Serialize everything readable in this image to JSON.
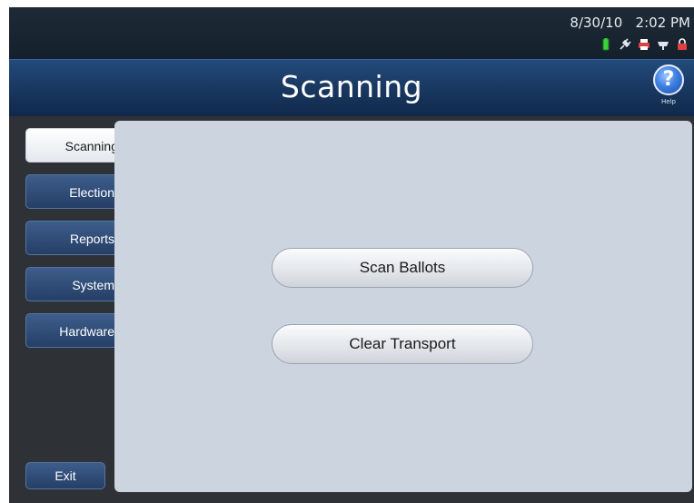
{
  "status": {
    "date": "8/30/10",
    "time": "2:02 PM",
    "icons": [
      "battery-icon",
      "power-plug-icon",
      "printer-icon",
      "network-icon",
      "lock-icon"
    ]
  },
  "header": {
    "title": "Scanning",
    "help_label": "Help",
    "help_glyph": "?"
  },
  "sidebar": {
    "tabs": [
      {
        "label": "Scanning",
        "active": true
      },
      {
        "label": "Election",
        "active": false
      },
      {
        "label": "Reports",
        "active": false
      },
      {
        "label": "System",
        "active": false
      },
      {
        "label": "Hardware",
        "active": false
      }
    ],
    "exit_label": "Exit"
  },
  "main": {
    "actions": [
      {
        "label": "Scan Ballots"
      },
      {
        "label": "Clear Transport"
      }
    ]
  },
  "colors": {
    "header_blue": "#1a3a63",
    "panel_bg": "#ccd4e0",
    "sidebar_bg": "#2e3136",
    "battery_green": "#3cd23c"
  }
}
